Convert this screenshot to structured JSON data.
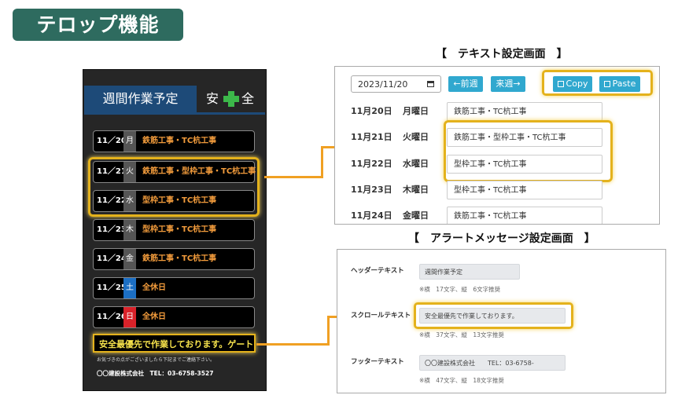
{
  "title": "テロップ機能",
  "signboard": {
    "header": "週間作業予定",
    "safety_left": "安",
    "safety_right": "全",
    "safety_icon": "green-cross-icon",
    "rows": [
      {
        "date": "11／20",
        "dow": "月",
        "text": "鉄筋工事・TC杭工事",
        "dow_color": "#555555"
      },
      {
        "date": "11／21",
        "dow": "火",
        "text": "鉄筋工事・型枠工事・TC杭工事",
        "dow_color": "#555555"
      },
      {
        "date": "11／22",
        "dow": "水",
        "text": "型枠工事・TC杭工事",
        "dow_color": "#555555"
      },
      {
        "date": "11／23",
        "dow": "木",
        "text": "型枠工事・TC杭工事",
        "dow_color": "#555555"
      },
      {
        "date": "11／24",
        "dow": "金",
        "text": "鉄筋工事・TC杭工事",
        "dow_color": "#555555"
      },
      {
        "date": "11／25",
        "dow": "土",
        "text": "全休日",
        "dow_color": "#1c6fc4"
      },
      {
        "date": "11／26",
        "dow": "日",
        "text": "全休日",
        "dow_color": "#d9222a"
      }
    ],
    "ticker": "安全最優先で作業しております。ゲート",
    "note": "お気づきの点がございましたら下記までご連絡下さい。",
    "footer": "〇〇建設株式会社　TEL：03-6758-3527"
  },
  "text_settings": {
    "caption": "【　テキスト設定画面　】",
    "date_value": "2023/11/20",
    "prev_week": "←前週",
    "next_week": "来週→",
    "copy": "Copy",
    "paste": "Paste",
    "rows": [
      {
        "date": "11月20日",
        "dow": "月曜日",
        "value": "鉄筋工事・TC杭工事"
      },
      {
        "date": "11月21日",
        "dow": "火曜日",
        "value": "鉄筋工事・型枠工事・TC杭工事"
      },
      {
        "date": "11月22日",
        "dow": "水曜日",
        "value": "型枠工事・TC杭工事"
      },
      {
        "date": "11月23日",
        "dow": "木曜日",
        "value": "型枠工事・TC杭工事"
      },
      {
        "date": "11月24日",
        "dow": "金曜日",
        "value": "鉄筋工事・TC杭工事"
      }
    ]
  },
  "alert_settings": {
    "caption": "【　アラートメッセージ設定画面　】",
    "header_label": "ヘッダーテキスト",
    "header_value": "週間作業予定",
    "header_note": "※横　17文字、縦　6文字推奨",
    "scroll_label": "スクロールテキスト",
    "scroll_value": "安全最優先で作業しております。",
    "scroll_note": "※横　37文字、縦　13文字推奨",
    "footer_label": "フッターテキスト",
    "footer_value": "〇〇建設株式会社　　TEL：03-6758-",
    "footer_note": "※横　47文字、縦　18文字推奨"
  },
  "colors": {
    "title_bg": "#2e6b5f",
    "highlight": "#e4b21c",
    "button": "#30a8cf",
    "board_text": "#f39c3c",
    "ticker_text": "#f7e34c"
  }
}
